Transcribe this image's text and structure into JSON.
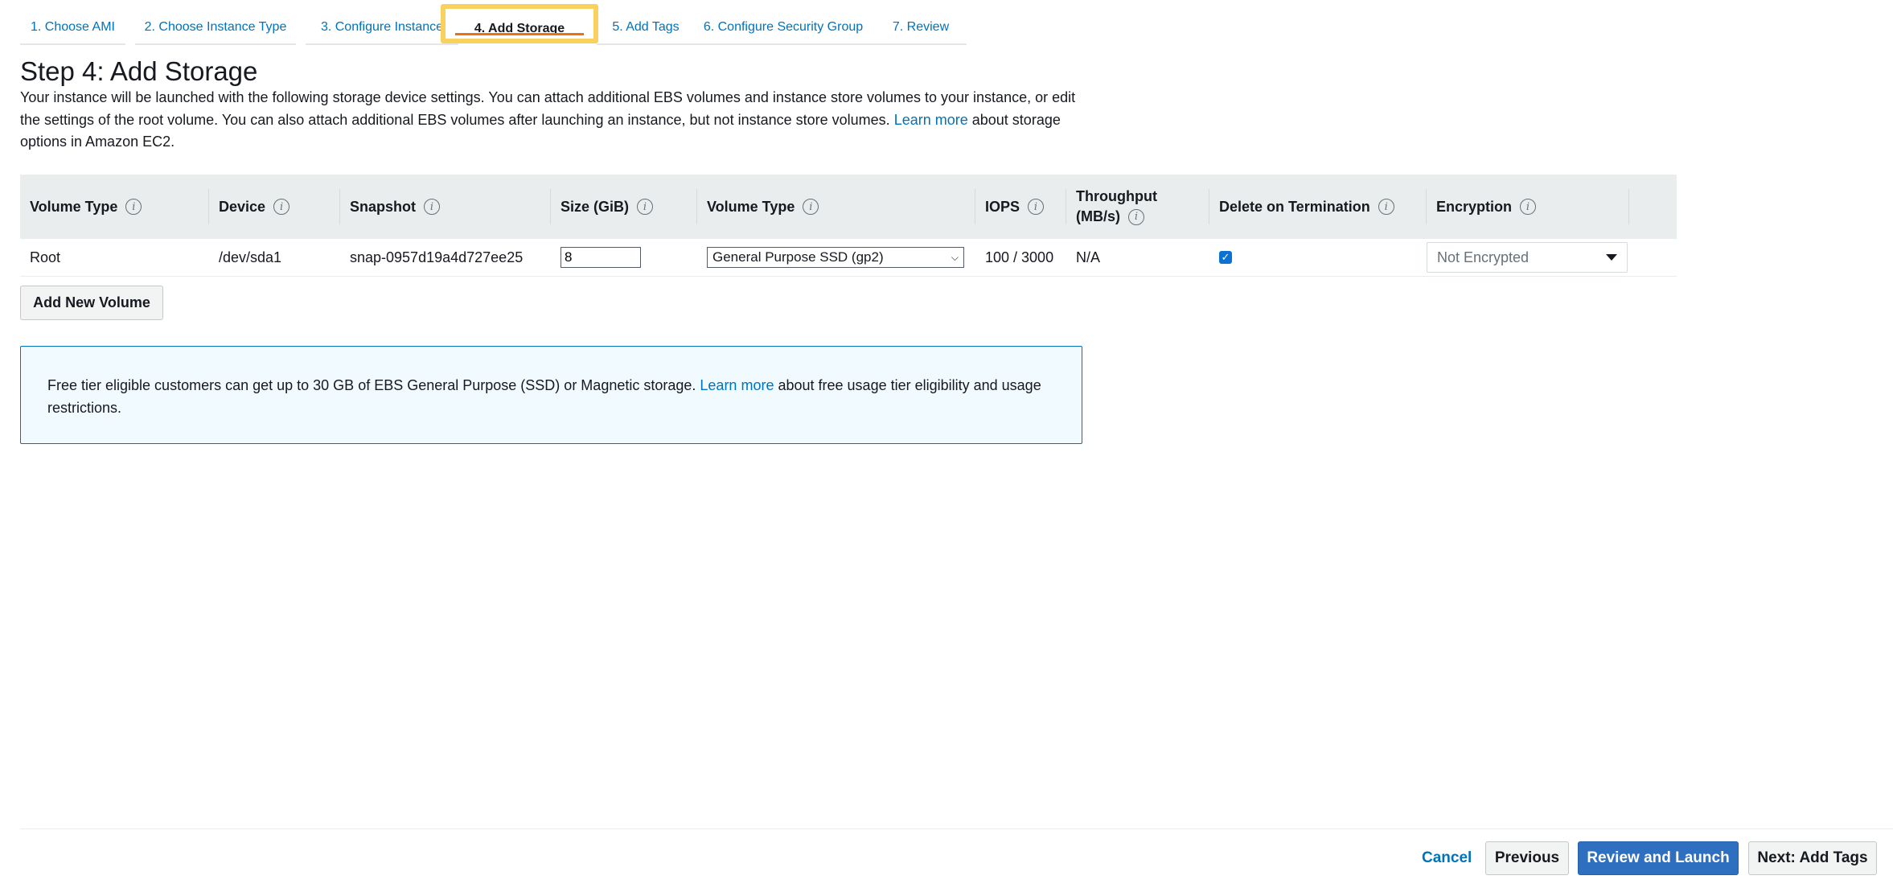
{
  "tabs": [
    {
      "label": "1. Choose AMI"
    },
    {
      "label": "2. Choose Instance Type"
    },
    {
      "label": "3. Configure Instance"
    },
    {
      "label": "4. Add Storage",
      "active": true
    },
    {
      "label": "5. Add Tags"
    },
    {
      "label": "6. Configure Security Group"
    },
    {
      "label": "7. Review"
    }
  ],
  "page": {
    "title": "Step 4: Add Storage",
    "intro_1": "Your instance will be launched with the following storage device settings. You can attach additional EBS volumes and instance store volumes to your instance, or edit the settings of the root volume. You can also attach additional EBS volumes after launching an instance, but not instance store volumes.",
    "intro_link": "Learn more",
    "intro_2": "about storage options in Amazon EC2."
  },
  "table": {
    "headers": {
      "volume_type": "Volume Type",
      "device": "Device",
      "snapshot": "Snapshot",
      "size": "Size (GiB)",
      "volume_type_2": "Volume Type",
      "iops": "IOPS",
      "throughput_1": "Throughput",
      "throughput_2": "(MB/s)",
      "delete_on_termination": "Delete on Termination",
      "encryption": "Encryption"
    },
    "rows": [
      {
        "volume_type": "Root",
        "device": "/dev/sda1",
        "snapshot": "snap-0957d19a4d727ee25",
        "size": "8",
        "ebs_type": "General Purpose SSD (gp2)",
        "iops": "100 / 3000",
        "throughput": "N/A",
        "delete_on_termination": true,
        "encryption": "Not Encrypted"
      }
    ]
  },
  "add_volume_label": "Add New Volume",
  "info": {
    "text_1": "Free tier eligible customers can get up to 30 GB of EBS General Purpose (SSD) or Magnetic storage.",
    "link": "Learn more",
    "text_2": "about free usage tier eligibility and usage restrictions."
  },
  "footer": {
    "cancel": "Cancel",
    "previous": "Previous",
    "review_launch": "Review and Launch",
    "next": "Next: Add Tags"
  },
  "colors": {
    "accent_link": "#0073bb",
    "primary_button": "#2f6fbf",
    "active_tab_highlight": "#f9d15f",
    "table_header_bg": "#eaeded"
  },
  "icons": {
    "info": "info-icon",
    "checkbox": "checkbox-checked-icon",
    "dropdown": "caret-down-icon"
  }
}
